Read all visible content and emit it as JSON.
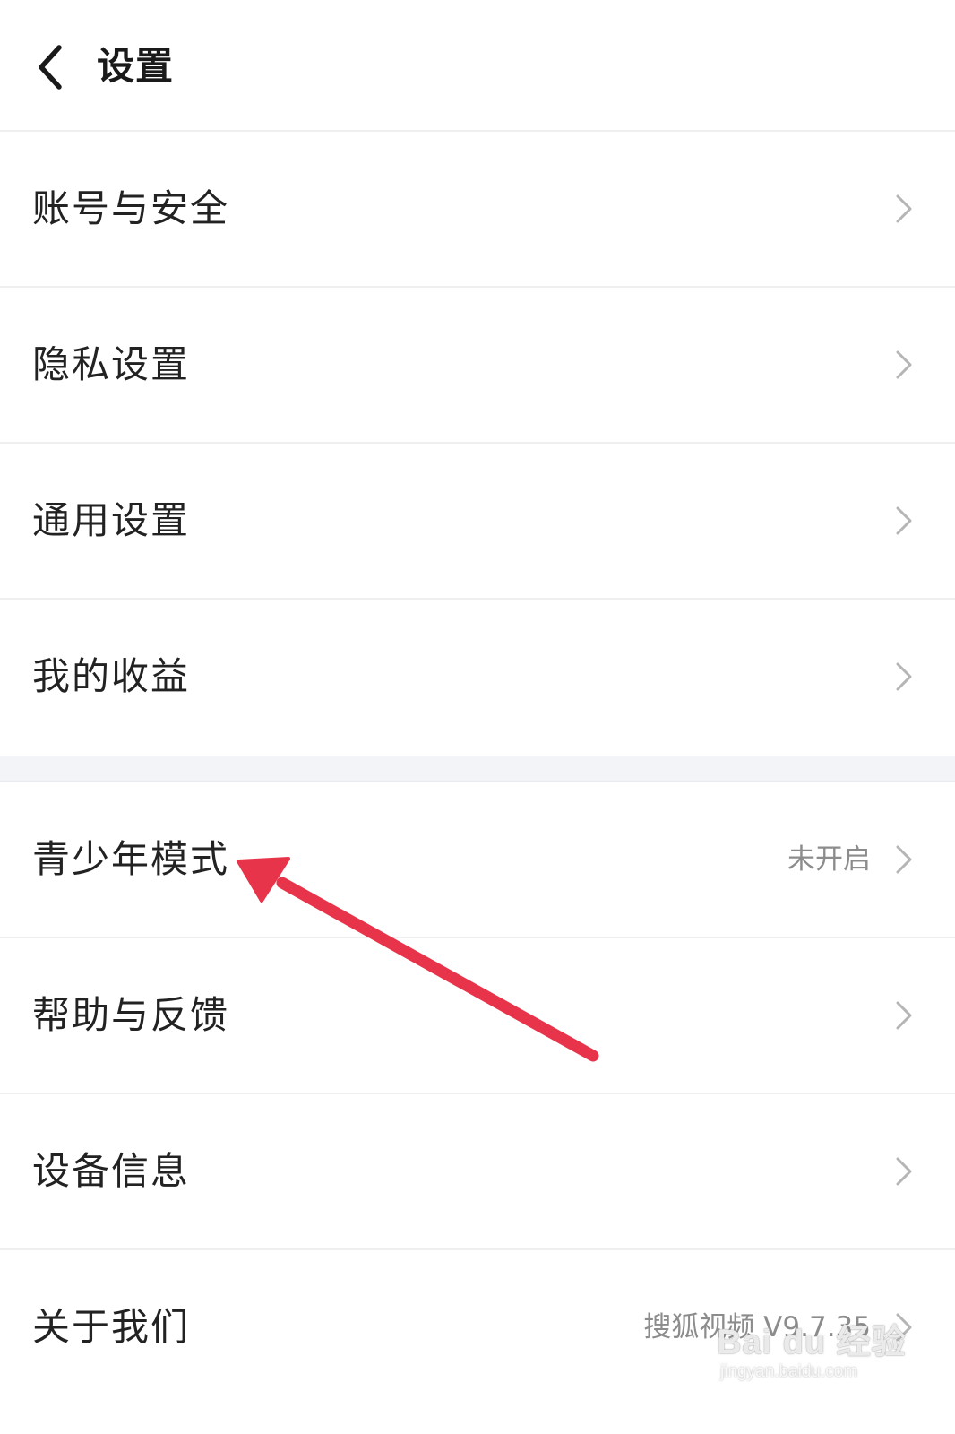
{
  "header": {
    "title": "设置",
    "back_icon": "chevron-left-icon"
  },
  "rows": [
    {
      "label": "账号与安全",
      "value": ""
    },
    {
      "label": "隐私设置",
      "value": ""
    },
    {
      "label": "通用设置",
      "value": ""
    },
    {
      "label": "我的收益",
      "value": ""
    },
    {
      "label": "青少年模式",
      "value": "未开启"
    },
    {
      "label": "帮助与反馈",
      "value": ""
    },
    {
      "label": "设备信息",
      "value": ""
    },
    {
      "label": "关于我们",
      "value": "搜狐视频 V9.7.35"
    }
  ],
  "row_icon": "chevron-right-icon",
  "annotation": {
    "arrow_color": "#e8344a",
    "target": "青少年模式"
  },
  "watermark": {
    "logo": "Bai du 经验",
    "url": "jingyan.baidu.com"
  }
}
